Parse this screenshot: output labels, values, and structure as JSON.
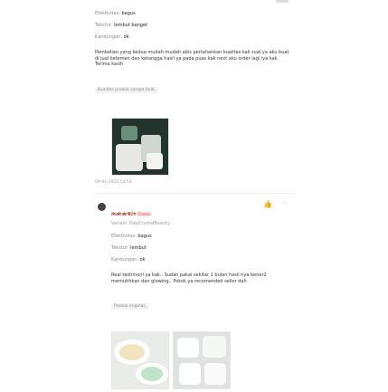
{
  "review1": {
    "efektivitas": {
      "label": "Efektivitas:",
      "value": "bagus"
    },
    "tekstur": {
      "label": "Tekstur:",
      "value": "lembut banget"
    },
    "kandungan": {
      "label": "Kandungan:",
      "value": "ok"
    },
    "comment": "Pembelian yang kedua mudah-mudah abis pertahankan kualitas kak soal ya aku buat di jual ketemen dan ketangga hasil ya pada puas kak next aku order lagi iya kak\nTerima kasih",
    "tag": "Kualitas produk sangat baik,",
    "date": "09-01-2022 14:53"
  },
  "review2": {
    "username": "matnar02",
    "badge": "Classic",
    "stars": "★★★★★",
    "variasi": "Variasi: DayCrystalBeauty",
    "efektivitas": {
      "label": "Efektivitas:",
      "value": "bagus"
    },
    "tekstur": {
      "label": "Tekstur:",
      "value": "lembut"
    },
    "kandungan": {
      "label": "Kandungan:",
      "value": "ok"
    },
    "comment": "Real testimoni ya kak.. Sudah pakai sekitar 1 bulan hasil nya bener2 memutihkan dan glowing.. Pokok ya recomended seller dah",
    "tag": "Produk original,",
    "like_icon": "thumb-up-icon",
    "more_icon": "more-icon"
  }
}
